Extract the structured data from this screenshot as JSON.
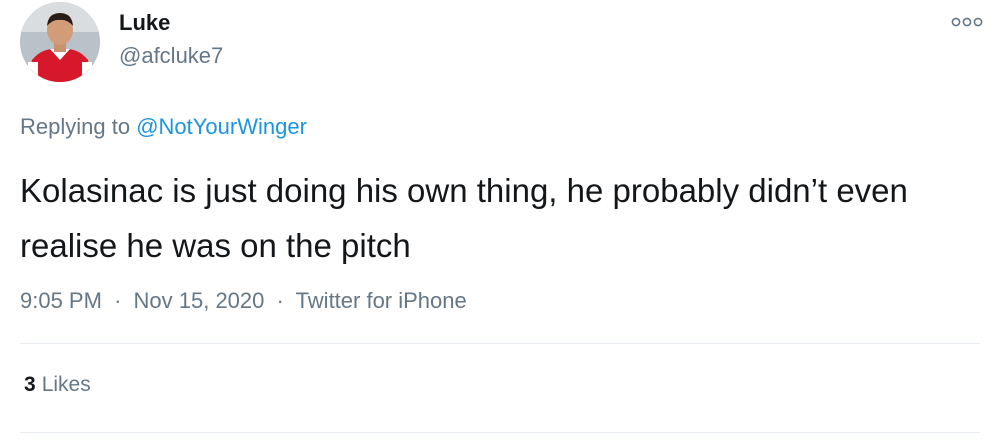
{
  "author": {
    "name": "Luke",
    "handle": "@afcluke7"
  },
  "reply": {
    "prefix": "Replying to",
    "mention": "@NotYourWinger"
  },
  "tweet": {
    "text": "Kolasinac is just doing his own thing, he probably didn’t even realise he was on the pitch"
  },
  "meta": {
    "time": "9:05 PM",
    "separator": "·",
    "date": "Nov 15, 2020",
    "source": "Twitter for iPhone"
  },
  "stats": {
    "likes_count": "3",
    "likes_label": "Likes"
  },
  "icons": {
    "more": "more-options-icon",
    "avatar": "profile-avatar"
  },
  "colors": {
    "text": "#14171a",
    "secondary": "#657786",
    "link": "#1b95e0",
    "divider": "#e6ecf0"
  }
}
